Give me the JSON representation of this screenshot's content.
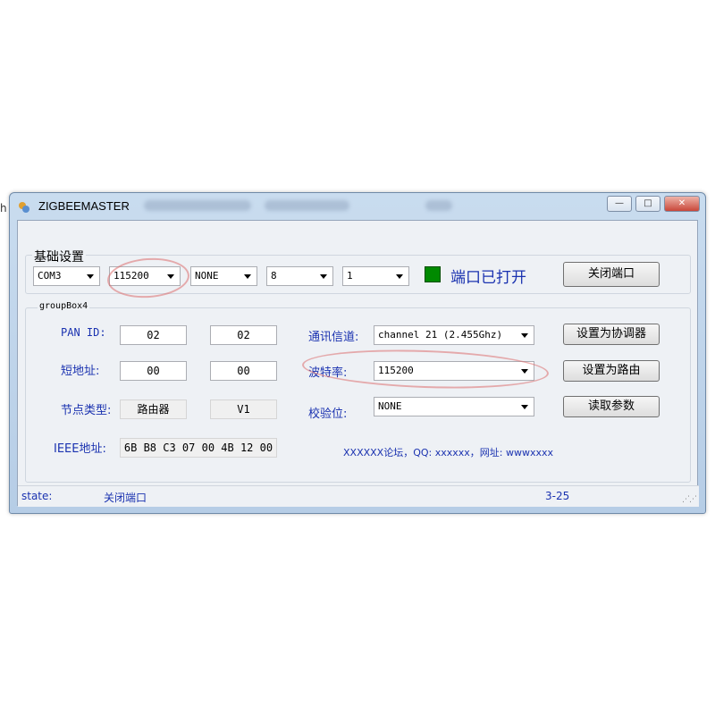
{
  "window": {
    "title": "ZIGBEEMASTER",
    "controls": {
      "minimize": "—",
      "maximize": "□",
      "close": "✕"
    }
  },
  "base_settings": {
    "group_title": "基础设置",
    "port": "COM3",
    "baud": "115200",
    "parity": "NONE",
    "databits": "8",
    "stopbits": "1",
    "indicator_color": "#008a00",
    "port_status": "端口已打开",
    "close_port_button": "关闭端口"
  },
  "groupbox4": {
    "title": "groupBox4",
    "pan_id_label": "PAN ID:",
    "pan_id_1": "02",
    "pan_id_2": "02",
    "short_addr_label": "短地址:",
    "short_addr_1": "00",
    "short_addr_2": "00",
    "node_type_label": "节点类型:",
    "node_type": "路由器",
    "version": "V1",
    "ieee_label": "IEEE地址:",
    "ieee_value": "6B B8 C3 07 00 4B 12 00",
    "channel_label": "通讯信道:",
    "channel_value": "channel 21 (2.455Ghz)",
    "baud_label": "波特率:",
    "baud_value": "115200",
    "parity_label": "校验位:",
    "parity_value": "NONE",
    "set_coordinator_button": "设置为协调器",
    "set_router_button": "设置为路由",
    "read_params_button": "读取参数",
    "forum_text": "XXXXXX论坛，QQ: xxxxxx，网址: wwwxxxx"
  },
  "statusbar": {
    "state_label": "state:",
    "state_value": "关闭端口",
    "counter": "3-25"
  },
  "outside_stub": "h"
}
